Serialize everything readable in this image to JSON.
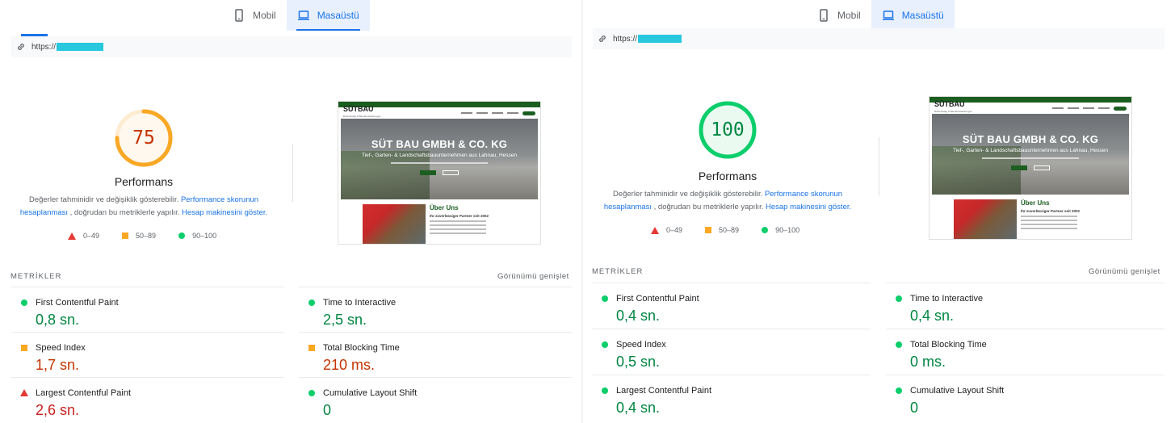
{
  "colors": {
    "good": "#0cce6b",
    "average": "#f9a825",
    "poor": "#e53935",
    "accent": "#1a73e8"
  },
  "tabs": {
    "mobile_label": "Mobil",
    "desktop_label": "Masaüstü"
  },
  "url_prefix": "https://",
  "shared": {
    "desc_text_1": "Değerler tahminidir ve değişiklik gösterebilir.",
    "desc_link_1": "Performance skorunun hesaplanması",
    "desc_text_2": ", doğrudan bu metriklerle yapılır.",
    "desc_link_2": "Hesap makinesini göster.",
    "legend": {
      "poor": "0–49",
      "average": "50–89",
      "good": "90–100"
    },
    "metrics_title": "METRİKLER",
    "expand_label": "Görünümü genişlet",
    "screenshot": {
      "logo": "SÜTBAU",
      "logo_sub": "Bodenbelag & Baudienstleistungen",
      "hero_title": "SÜT BAU GMBH & CO. KG",
      "hero_sub": "Tief-, Garten- & Landschaftsbauunternehmen aus Lahnau, Hessen",
      "section_title": "Über Uns",
      "section_sub": "Ihr zuverlässiger Partner seit 2002"
    }
  },
  "left": {
    "score": 75,
    "score_color": "#f9a825",
    "score_label": "Performans",
    "metrics": [
      {
        "name": "First Contentful Paint",
        "value": "0,8 sn.",
        "status": "good"
      },
      {
        "name": "Time to Interactive",
        "value": "2,5 sn.",
        "status": "good"
      },
      {
        "name": "Speed Index",
        "value": "1,7 sn.",
        "status": "average"
      },
      {
        "name": "Total Blocking Time",
        "value": "210 ms.",
        "status": "average"
      },
      {
        "name": "Largest Contentful Paint",
        "value": "2,6 sn.",
        "status": "poor"
      },
      {
        "name": "Cumulative Layout Shift",
        "value": "0",
        "status": "good"
      }
    ]
  },
  "right": {
    "score": 100,
    "score_color": "#0cce6b",
    "score_label": "Performans",
    "metrics": [
      {
        "name": "First Contentful Paint",
        "value": "0,4 sn.",
        "status": "good"
      },
      {
        "name": "Time to Interactive",
        "value": "0,4 sn.",
        "status": "good"
      },
      {
        "name": "Speed Index",
        "value": "0,5 sn.",
        "status": "good"
      },
      {
        "name": "Total Blocking Time",
        "value": "0 ms.",
        "status": "good"
      },
      {
        "name": "Largest Contentful Paint",
        "value": "0,4 sn.",
        "status": "good"
      },
      {
        "name": "Cumulative Layout Shift",
        "value": "0",
        "status": "good"
      }
    ]
  }
}
